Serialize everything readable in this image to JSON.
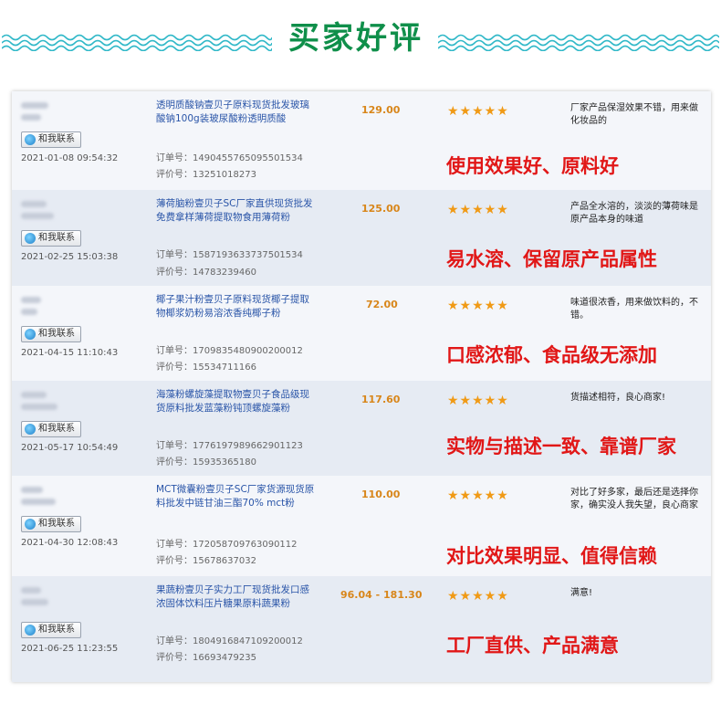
{
  "header": {
    "title": "买家好评"
  },
  "colors": {
    "title": "#0f8f4a",
    "wave": "#30b8c8",
    "tag": "#e11717",
    "price": "#d8861a",
    "star": "#f09a16",
    "link": "#2a55a8"
  },
  "contact_label": "和我联系",
  "order_prefix": "订单号：",
  "review_prefix": "评价号：",
  "stars_display": "★★★★★",
  "reviews": [
    {
      "date": "2021-01-08 09:54:32",
      "product": "透明质酸钠壹贝子原料现货批发玻璃酸钠100g装玻尿酸粉透明质酸",
      "order_no": "订单号：1490455765095501534",
      "review_no": "评价号：13251018273",
      "price": "129.00",
      "rating": 5,
      "comment": "厂家产品保湿效果不错，用来做化妆品的",
      "tag": "使用效果好、原料好"
    },
    {
      "date": "2021-02-25 15:03:38",
      "product": "薄荷脑粉壹贝子SC厂家直供现货批发免费拿样薄荷提取物食用薄荷粉",
      "order_no": "订单号：1587193633737501534",
      "review_no": "评价号：14783239460",
      "price": "125.00",
      "rating": 5,
      "comment": "产品全水溶的，淡淡的薄荷味是原产品本身的味道",
      "tag": "易水溶、保留原产品属性"
    },
    {
      "date": "2021-04-15 11:10:43",
      "product": "椰子果汁粉壹贝子原料现货椰子提取物椰浆奶粉易溶浓香纯椰子粉",
      "order_no": "订单号：1709835480900200012",
      "review_no": "评价号：15534711166",
      "price": "72.00",
      "rating": 5,
      "comment": "味道很浓香，用来做饮料的，不错。",
      "tag": "口感浓郁、食品级无添加"
    },
    {
      "date": "2021-05-17 10:54:49",
      "product": "海藻粉螺旋藻提取物壹贝子食品级现货原料批发蓝藻粉钝顶螺旋藻粉",
      "order_no": "订单号：1776197989662901123",
      "review_no": "评价号：15935365180",
      "price": "117.60",
      "rating": 5,
      "comment": "货描述相符，良心商家!",
      "tag": "实物与描述一致、靠谱厂家"
    },
    {
      "date": "2021-04-30 12:08:43",
      "product": "MCT微囊粉壹贝子SC厂家货源现货原料批发中链甘油三酯70% mct粉",
      "order_no": "订单号：1720587097630901​12",
      "review_no": "评价号：15678637032",
      "price": "110.00",
      "rating": 5,
      "comment": "对比了好多家，最后还是选择你家，确实没人我失望，良心商家",
      "tag": "对比效果明显、值得信赖"
    },
    {
      "date": "2021-06-25 11:23:55",
      "product": "果蔬粉壹贝子实力工厂现货批发口感浓固体饮料压片糖果原料蔬果粉",
      "order_no": "订单号：1804916847109200012",
      "review_no": "评价号：16693479235",
      "price": "96.04 - 181.30",
      "rating": 5,
      "comment": "满意!",
      "tag": "工厂直供、产品满意"
    }
  ]
}
